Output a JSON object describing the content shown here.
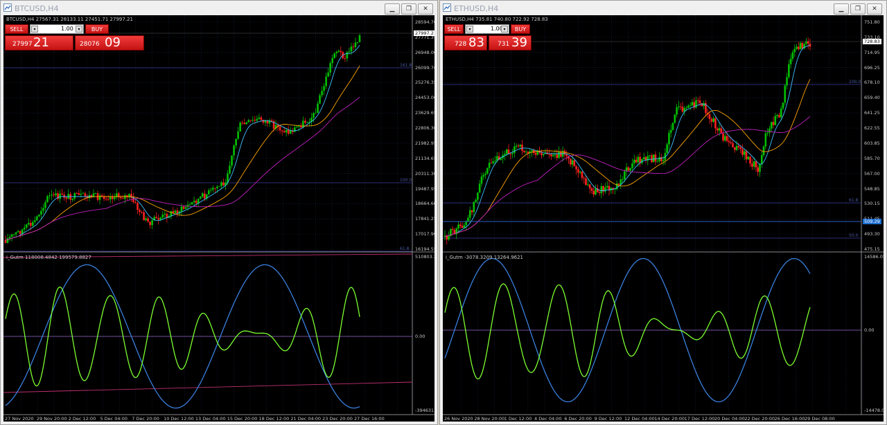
{
  "windows": [
    {
      "id": "btc",
      "title": "BTCUSD,H4",
      "header": "BTCUSD,H4  27567.31 28133.11 27451.71 27997.21",
      "trade_panel": {
        "sell_label": "SELL",
        "buy_label": "BUY",
        "lot": "1.00",
        "sell_small": "27997",
        "sell_big": "21",
        "buy_small": "28076",
        "buy_big": "09"
      },
      "y_ticks": [
        "28594.70",
        "27771.35",
        "26948.00",
        "26099.70",
        "25276.35",
        "24453.00",
        "23629.65",
        "22806.30",
        "21982.95",
        "21134.65",
        "20311.30",
        "19487.95",
        "18664.60",
        "17841.25",
        "17017.90",
        "16194.55"
      ],
      "current_price": "27997.21",
      "levels": [
        "161.8",
        "100.0",
        "61.8"
      ],
      "osc_label": "i_Gutm 118008.4842 199579.8827",
      "osc_ticks": [
        "510803.282",
        "0.00",
        "-394631.31"
      ],
      "x_ticks": [
        "27 Nov 2020",
        "29 Nov 20:00",
        "2 Dec 12:00",
        "5 Dec 04:00",
        "7 Dec 20:00",
        "10 Dec 12:00",
        "13 Dec 04:00",
        "15 Dec 20:00",
        "18 Dec 12:00",
        "21 Dec 04:00",
        "23 Dec 20:00",
        "27 Dec 16:00"
      ]
    },
    {
      "id": "eth",
      "title": "ETHUSD,H4",
      "header": "ETHUSD,H4  735.81 740.80 722.92 728.83",
      "trade_panel": {
        "sell_label": "SELL",
        "buy_label": "BUY",
        "lot": "1.00",
        "sell_small": "728",
        "sell_big": "83",
        "buy_small": "731",
        "buy_big": "39"
      },
      "y_ticks": [
        "751.80",
        "733.10",
        "714.95",
        "696.25",
        "678.10",
        "659.40",
        "641.25",
        "622.55",
        "603.85",
        "585.70",
        "567.00",
        "548.85",
        "530.15",
        "511.45",
        "493.30",
        "475.15"
      ],
      "current_price": "728.83",
      "blue_price": "509.29",
      "levels": [
        "100.0",
        "61.8",
        "50.0"
      ],
      "osc_label": "i_Gutm -3078.3209 13264.9621",
      "osc_ticks": [
        "14586.05",
        "0.00",
        "-14478.06"
      ],
      "x_ticks": [
        "26 Nov 2020",
        "28 Nov 20:00",
        "1 Dec 12:00",
        "4 Dec 04:00",
        "6 Dec 20:00",
        "9 Dec 12:00",
        "12 Dec 04:00",
        "14 Dec 20:00",
        "17 Dec 12:00",
        "20 Dec 04:00",
        "22 Dec 20:00",
        "26 Dec 16:00",
        "29 Dec 08:00"
      ]
    }
  ],
  "window_buttons": {
    "minimize": "▁",
    "restore": "❐",
    "close": "✕"
  },
  "colors": {
    "bull": "#00c000",
    "bear": "#ff2020",
    "ma_fast": "#40c0ff",
    "ma_mid": "#ffa500",
    "ma_slow": "#c020c0",
    "osc_fast": "#7cff30",
    "osc_slow": "#3a80e0",
    "grid": "#1c2848"
  }
}
